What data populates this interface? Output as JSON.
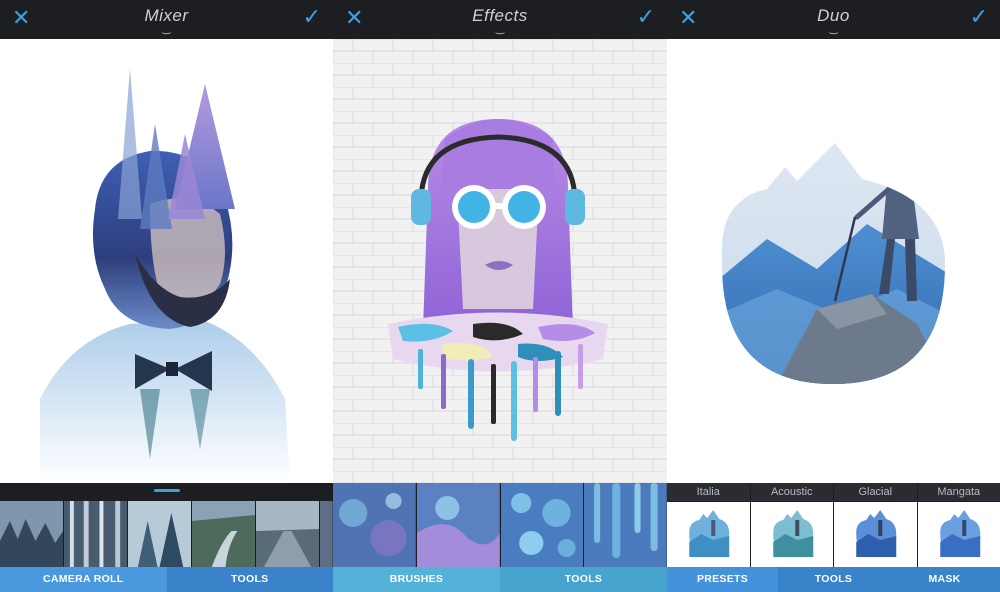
{
  "panels": [
    {
      "title": "Mixer",
      "tabs": [
        "CAMERA ROLL",
        "TOOLS"
      ]
    },
    {
      "title": "Effects",
      "tabs": [
        "BRUSHES",
        "TOOLS"
      ]
    },
    {
      "title": "Duo",
      "presets": [
        "Italia",
        "Acoustic",
        "Glacial",
        "Mangata"
      ],
      "tabs": [
        "PRESETS",
        "TOOLS",
        "MASK"
      ]
    }
  ],
  "icons": {
    "close": "close-icon",
    "confirm": "checkmark-icon",
    "dropdown": "chevron-down-icon"
  },
  "colors": {
    "accent": "#3aa3e3",
    "bar_dark": "#1d1e22",
    "tab_blue": "#3d8ad3"
  }
}
